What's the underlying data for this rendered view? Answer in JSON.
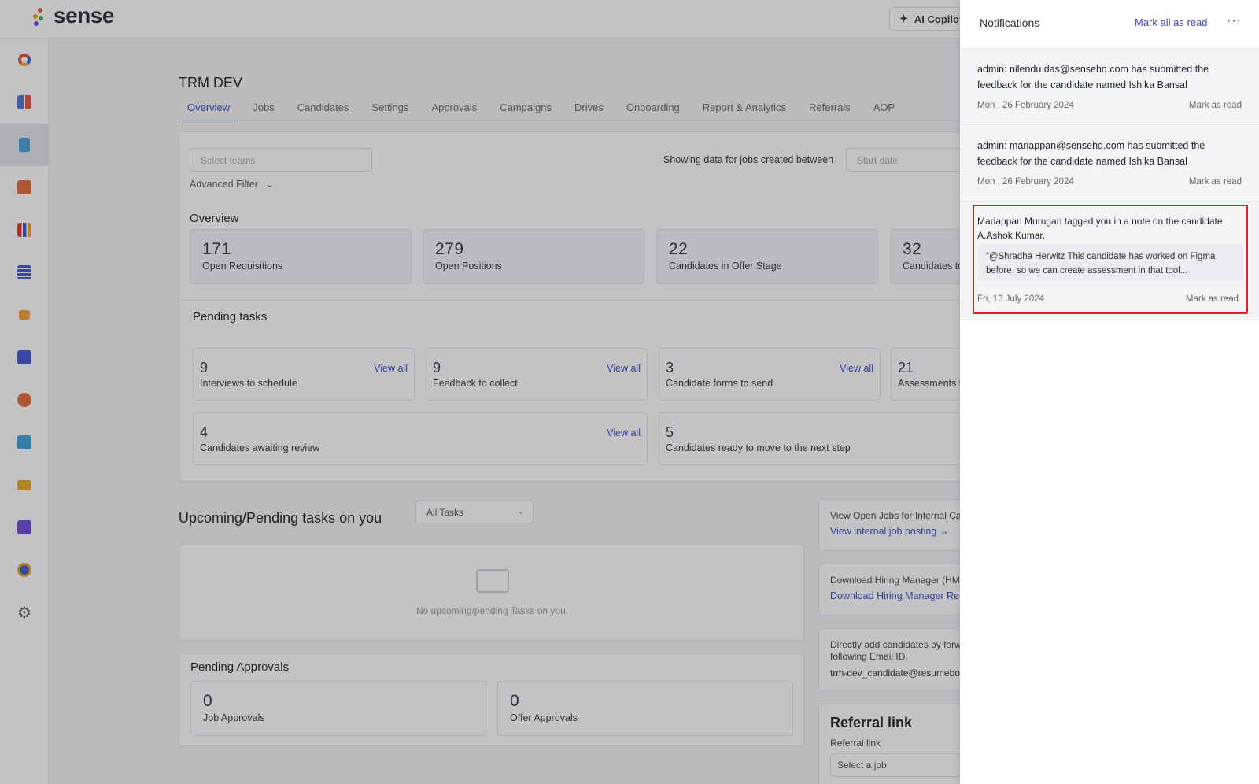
{
  "brand": {
    "name": "sense"
  },
  "header": {
    "copilot_label": "AI Copilot"
  },
  "sidebar": {
    "items": [
      {
        "icon": "donut-icon",
        "color": "#e0533b"
      },
      {
        "icon": "grid-icon",
        "color": "#4c6fd6"
      },
      {
        "icon": "document-icon",
        "color": "#4aa0d6",
        "active": true
      },
      {
        "icon": "puzzle-icon",
        "color": "#e06b3b"
      },
      {
        "icon": "bar-chart-icon",
        "color": "#d9392c"
      },
      {
        "icon": "list-icon",
        "color": "#3f56c9"
      },
      {
        "icon": "megaphone-icon",
        "color": "#f0a030"
      },
      {
        "icon": "calendar-icon",
        "color": "#3f56c9"
      },
      {
        "icon": "team-icon",
        "color": "#e06b3b"
      },
      {
        "icon": "bot-icon",
        "color": "#3aa0d6"
      },
      {
        "icon": "chat-icon",
        "color": "#e2a820"
      },
      {
        "icon": "contact-icon",
        "color": "#6c4ad6"
      },
      {
        "icon": "clock-icon",
        "color": "#e2a820"
      },
      {
        "icon": "gear-icon",
        "color": "#555555"
      }
    ]
  },
  "page": {
    "title": "TRM DEV",
    "tabs": [
      "Overview",
      "Jobs",
      "Candidates",
      "Settings",
      "Approvals",
      "Campaigns",
      "Drives",
      "Onboarding",
      "Report & Analytics",
      "Referrals",
      "AOP"
    ],
    "select_teams_placeholder": "Select teams",
    "advanced_filter": "Advanced Filter",
    "showing_text": "Showing data for jobs created between",
    "start_date_placeholder": "Start date"
  },
  "overview": {
    "heading": "Overview",
    "stats": [
      {
        "num": "171",
        "label": "Open Requisitions"
      },
      {
        "num": "279",
        "label": "Open Positions"
      },
      {
        "num": "22",
        "label": "Candidates in Offer Stage"
      },
      {
        "num": "32",
        "label": "Candidates to"
      }
    ]
  },
  "pending_tasks": {
    "heading": "Pending tasks",
    "view_all": "View all",
    "items": [
      {
        "num": "9",
        "label": "Interviews to schedule"
      },
      {
        "num": "9",
        "label": "Feedback to collect"
      },
      {
        "num": "3",
        "label": "Candidate forms to send"
      },
      {
        "num": "21",
        "label": "Assessments t"
      },
      {
        "num": "4",
        "label": "Candidates awaiting review"
      },
      {
        "num": "5",
        "label": "Candidates ready to move to the next step"
      }
    ]
  },
  "upcoming": {
    "title": "Upcoming/Pending tasks on you",
    "filter": "All Tasks",
    "empty": "No upcoming/pending Tasks on you."
  },
  "approvals": {
    "heading": "Pending Approvals",
    "items": [
      {
        "num": "0",
        "label": "Job Approvals"
      },
      {
        "num": "0",
        "label": "Offer Approvals"
      }
    ]
  },
  "right_cards": {
    "internal": {
      "text": "View Open Jobs for Internal Ca",
      "link": "View internal job posting →"
    },
    "download": {
      "text": "Download Hiring Manager (HM",
      "link": "Download Hiring Manager Re"
    },
    "email": {
      "text": "Directly add candidates by forw following Email ID.",
      "value": "trm-dev_candidate@resumebo"
    },
    "referral": {
      "title": "Referral link",
      "label": "Referral link",
      "placeholder": "Select a job"
    }
  },
  "notifications": {
    "title": "Notifications",
    "mark_all": "Mark all as read",
    "more": "···",
    "items": [
      {
        "text": "admin: nilendu.das@sensehq.com has submitted the feedback for the candidate named Ishika Bansal",
        "date": "Mon , 26 February 2024",
        "action": "Mark as read"
      },
      {
        "text": "admin: mariappan@sensehq.com has submitted the feedback for the candidate named Ishika Bansal",
        "date": "Mon , 26 February 2024",
        "action": "Mark as read"
      },
      {
        "text": "Mariappan Murugan tagged you in a note on the candidate A.Ashok Kumar.",
        "quote": "“@Shradha Herwitz This candidate has worked on Figma before, so we can create assessment in that tool...",
        "date": "Fri, 13 July 2024",
        "action": "Mark as read"
      }
    ]
  },
  "colors": {
    "accent": "#3a4bb7",
    "highlight": "#e0242a"
  }
}
